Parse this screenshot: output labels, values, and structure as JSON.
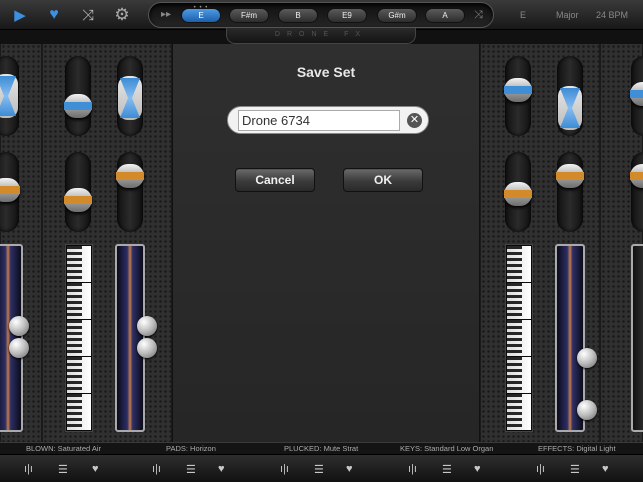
{
  "toolbar_top": {
    "icons": [
      "play-icon",
      "heart-icon",
      "shuffle-icon",
      "gear-icon"
    ],
    "chord_skip": "▸▸",
    "chords": [
      {
        "label": "E",
        "active": true
      },
      {
        "label": "F#m",
        "active": false
      },
      {
        "label": "B",
        "active": false
      },
      {
        "label": "E9",
        "active": false
      },
      {
        "label": "G#m",
        "active": false
      },
      {
        "label": "A",
        "active": false
      }
    ],
    "key": "E",
    "scale": "Major",
    "tempo": "24 BPM",
    "logo": "DRONE FX"
  },
  "dialog": {
    "title": "Save Set",
    "name_value": "Drone 6734",
    "cancel_label": "Cancel",
    "ok_label": "OK"
  },
  "status": {
    "blown": "BLOWN: Saturated Air",
    "pads": "PADS: Horizon",
    "plucked": "PLUCKED: Mute Strat",
    "keys": "KEYS: Standard Low Organ",
    "effects": "EFFECTS: Digital Light"
  },
  "colors": {
    "accent_blue": "#3d8fe0",
    "accent_orange": "#d38a2a"
  }
}
